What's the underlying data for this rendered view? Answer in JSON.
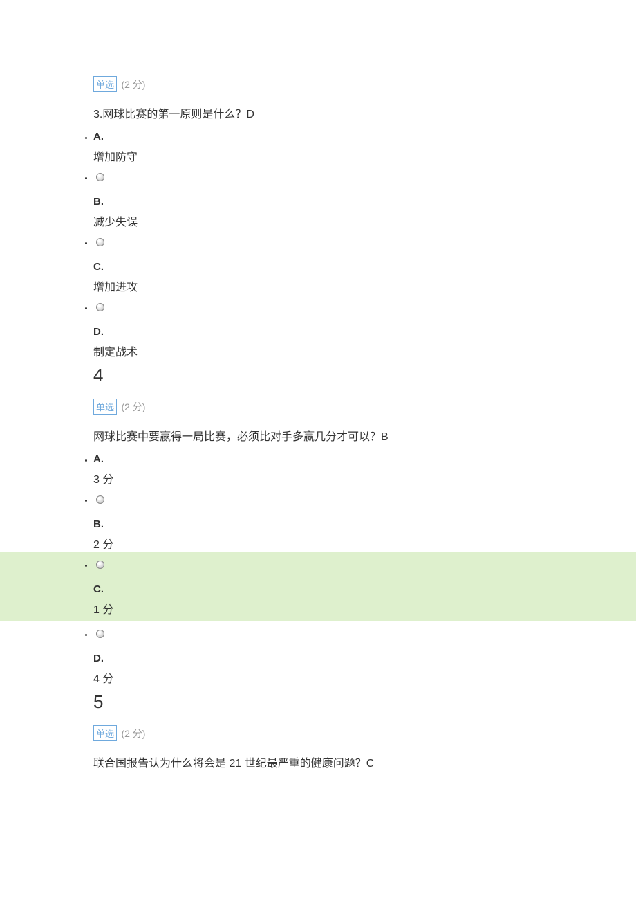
{
  "tag_label": "单选",
  "points_label": "(2 分)",
  "q3": {
    "text": "3.网球比赛的第一原则是什么？D",
    "options": {
      "A": {
        "letter": "A.",
        "text": "增加防守"
      },
      "B": {
        "letter": "B.",
        "text": "减少失误"
      },
      "C": {
        "letter": "C.",
        "text": "增加进攻"
      },
      "D": {
        "letter": "D.",
        "text": "制定战术"
      }
    }
  },
  "q4": {
    "num": "4",
    "text": "网球比赛中要赢得一局比赛，必须比对手多赢几分才可以？B",
    "options": {
      "A": {
        "letter": "A.",
        "text": "3 分"
      },
      "B": {
        "letter": "B.",
        "text": "2 分"
      },
      "C": {
        "letter": "C.",
        "text": "1 分"
      },
      "D": {
        "letter": "D.",
        "text": "4 分"
      }
    }
  },
  "q5": {
    "num": "5",
    "text": "联合国报告认为什么将会是 21 世纪最严重的健康问题？C"
  }
}
